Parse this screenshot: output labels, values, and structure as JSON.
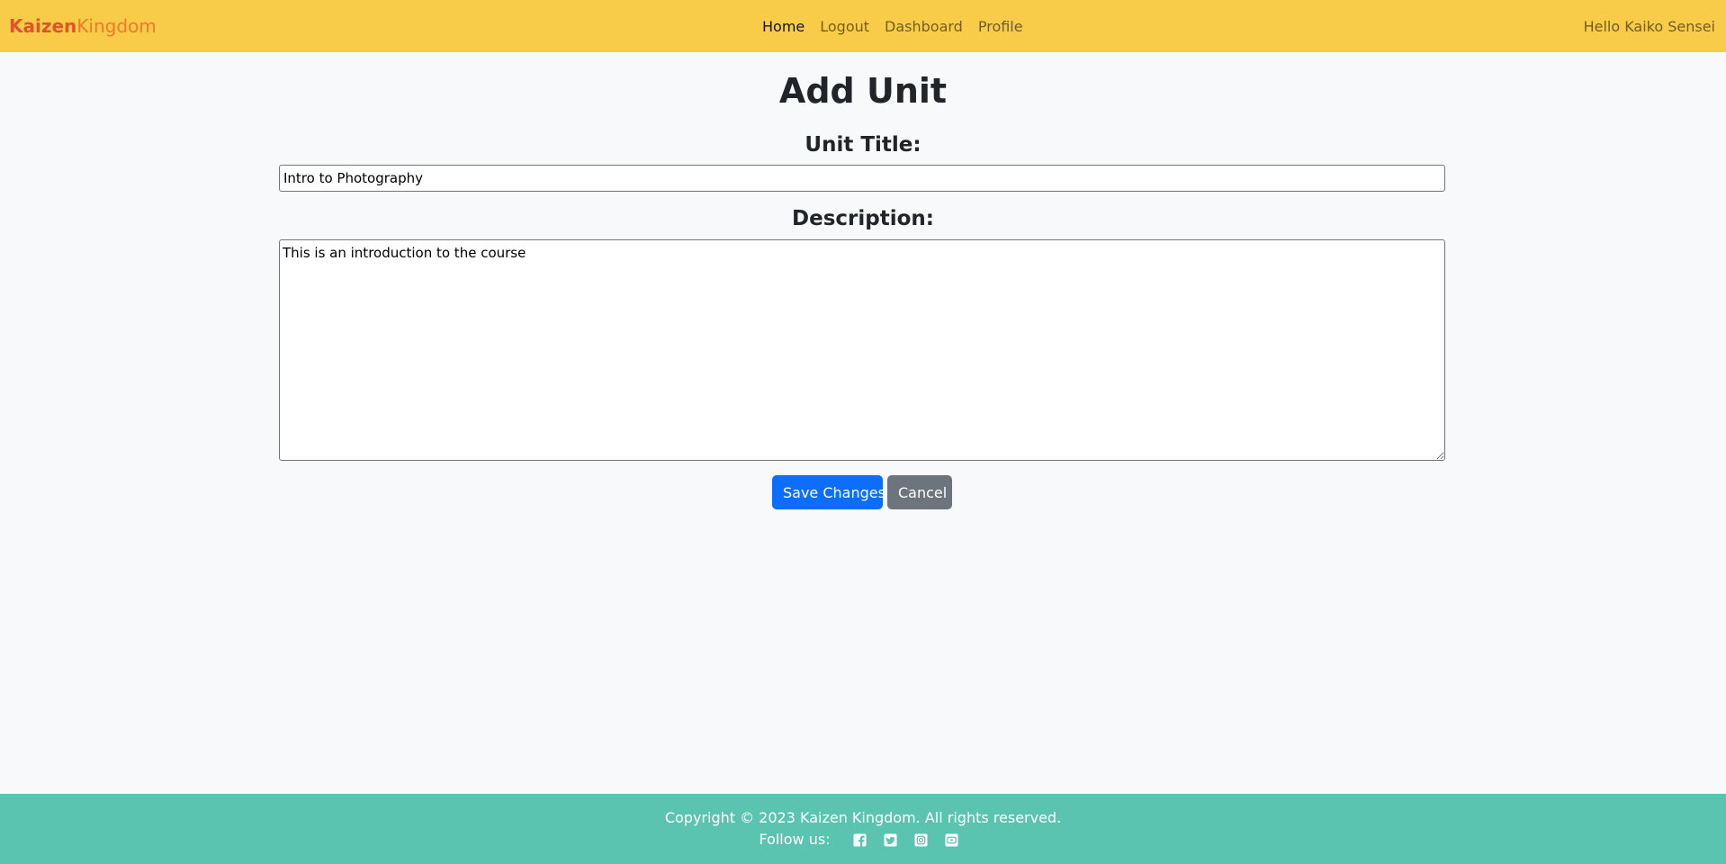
{
  "navbar": {
    "brand_part1": "Kaizen",
    "brand_part2": "Kingdom",
    "links": [
      {
        "label": "Home",
        "active": true
      },
      {
        "label": "Logout",
        "active": false
      },
      {
        "label": "Dashboard",
        "active": false
      },
      {
        "label": "Profile",
        "active": false
      }
    ],
    "greeting": "Hello Kaiko Sensei"
  },
  "form": {
    "heading": "Add Unit",
    "title_label": "Unit Title:",
    "title_value": "Intro to Photography",
    "description_label": "Description:",
    "description_value": "This is an introduction to the course",
    "save_label": "Save Changes",
    "cancel_label": "Cancel"
  },
  "footer": {
    "copyright": "Copyright © 2023 Kaizen Kingdom. All rights reserved.",
    "follow_label": "Follow us:",
    "social_icons": [
      "facebook-icon",
      "twitter-icon",
      "instagram-icon",
      "youtube-icon"
    ]
  },
  "colors": {
    "navbar_bg": "#f8cc48",
    "brand_primary": "#e0542c",
    "brand_secondary": "#f07a2a",
    "page_bg": "#f8f9fa",
    "save_button": "#0d6efd",
    "cancel_button": "#6c757d",
    "footer_bg": "#5bc4b1"
  }
}
